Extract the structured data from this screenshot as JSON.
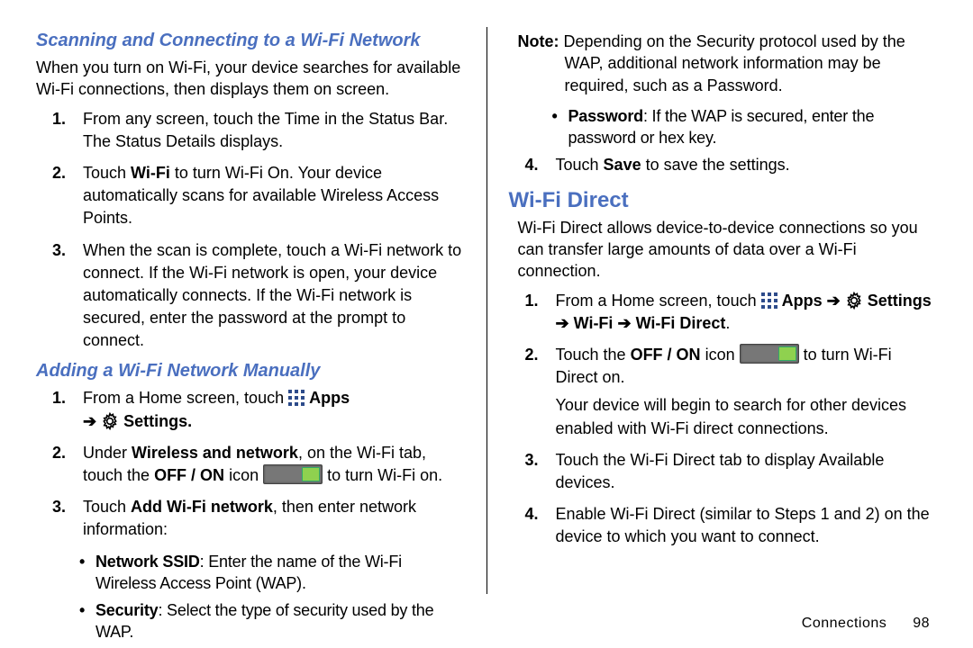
{
  "left": {
    "subhead1": "Scanning and Connecting to a Wi-Fi Network",
    "intro1": "When you turn on Wi-Fi, your device searches for available Wi-Fi connections, then displays them on screen.",
    "steps1": {
      "n1": "1.",
      "s1a": "From any screen, touch the Time in the Status Bar.",
      "s1b": "The Status Details displays.",
      "n2": "2.",
      "s2_pre": "Touch ",
      "s2_b1": "Wi-Fi",
      "s2_post": " to turn Wi-Fi On. Your device automatically scans for available Wireless Access Points.",
      "n3": "3.",
      "s3": "When the scan is complete, touch a Wi-Fi network to connect. If the Wi-Fi network is open, your device automatically connects. If the Wi-Fi network is secured, enter the password at the prompt to connect."
    },
    "subhead2": "Adding a Wi-Fi Network Manually",
    "steps2": {
      "n1": "1.",
      "s1_pre": "From a Home screen, touch ",
      "apps_lbl": "Apps",
      "arrow": "➔",
      "settings_lbl": "Settings.",
      "n2": "2.",
      "s2_pre": "Under ",
      "s2_b1": "Wireless and network",
      "s2_mid": ", on the Wi-Fi tab, touch the ",
      "s2_b2": "OFF / ON",
      "s2_mid2": " icon ",
      "s2_post": " to turn Wi-Fi on.",
      "n3": "3.",
      "s3_pre": "Touch ",
      "s3_b1": "Add Wi-Fi network",
      "s3_post": ", then enter network information:",
      "b1_label": "Network SSID",
      "b1_text": ": Enter the name of the Wi-Fi Wireless Access Point (WAP).",
      "b2_label": "Security",
      "b2_text": ": Select the type of security used by the WAP."
    }
  },
  "right": {
    "note_label": "Note:",
    "note_text": " Depending on the Security protocol used by the WAP, additional network information may be required, such as a Password.",
    "bp_label": "Password",
    "bp_text": ": If the WAP is secured, enter the password or hex key.",
    "n4": "4.",
    "s4_pre": "Touch ",
    "s4_b1": "Save",
    "s4_post": " to save the settings.",
    "sechead": "Wi-Fi Direct",
    "intro": "Wi-Fi Direct allows device-to-device connections so you can transfer large amounts of data over a Wi-Fi connection.",
    "steps": {
      "n1": "1.",
      "s1_pre": "From a Home screen, touch ",
      "apps_lbl": "Apps",
      "arrow": "➔",
      "settings_lbl": "Settings",
      "wifi_lbl": "Wi-Fi",
      "wfd_lbl": "Wi-Fi Direct",
      "dot": ".",
      "n2": "2.",
      "s2_pre": "Touch the ",
      "s2_b1": "OFF / ON",
      "s2_mid": " icon ",
      "s2_post": " to turn Wi-Fi Direct on.",
      "s2_line2": "Your device will begin to search for other devices enabled with Wi-Fi direct connections.",
      "n3": "3.",
      "s3": "Touch the Wi-Fi Direct tab to display Available devices.",
      "n4": "4.",
      "s4": "Enable Wi-Fi Direct (similar to Steps 1 and 2) on the device to which you want to connect."
    }
  },
  "footer": {
    "section": "Connections",
    "page": "98"
  }
}
